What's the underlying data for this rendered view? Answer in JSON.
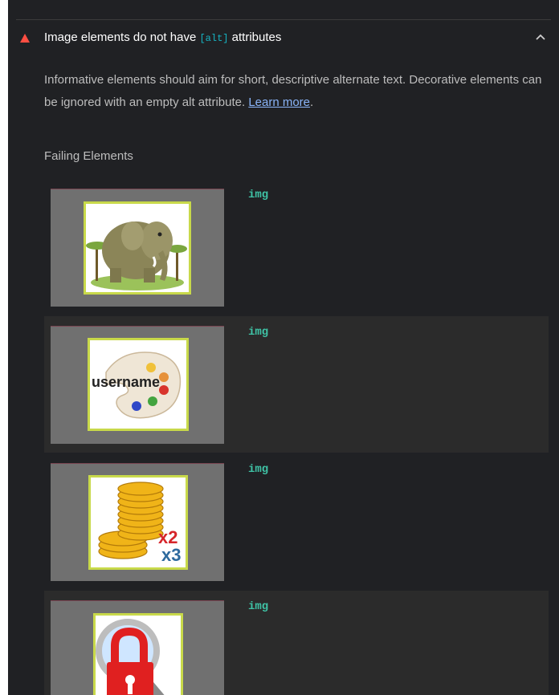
{
  "audit": {
    "title_prefix": "Image elements do not have ",
    "title_code": "[alt]",
    "title_suffix": " attributes",
    "description": "Informative elements should aim for short, descriptive alternate text. Decorative elements can be ignored with an empty alt attribute. ",
    "learn_more": "Learn more",
    "learn_more_suffix": ".",
    "section_title": "Failing Elements",
    "status_color": "#ff4e42"
  },
  "items": [
    {
      "tag": "img",
      "icon": "elephant-image"
    },
    {
      "tag": "img",
      "icon": "username-palette-image",
      "image_text": "username"
    },
    {
      "tag": "img",
      "icon": "gold-coins-image",
      "image_text_1": "x2",
      "image_text_2": "x3"
    },
    {
      "tag": "img",
      "icon": "padlock-magnifier-image"
    }
  ]
}
